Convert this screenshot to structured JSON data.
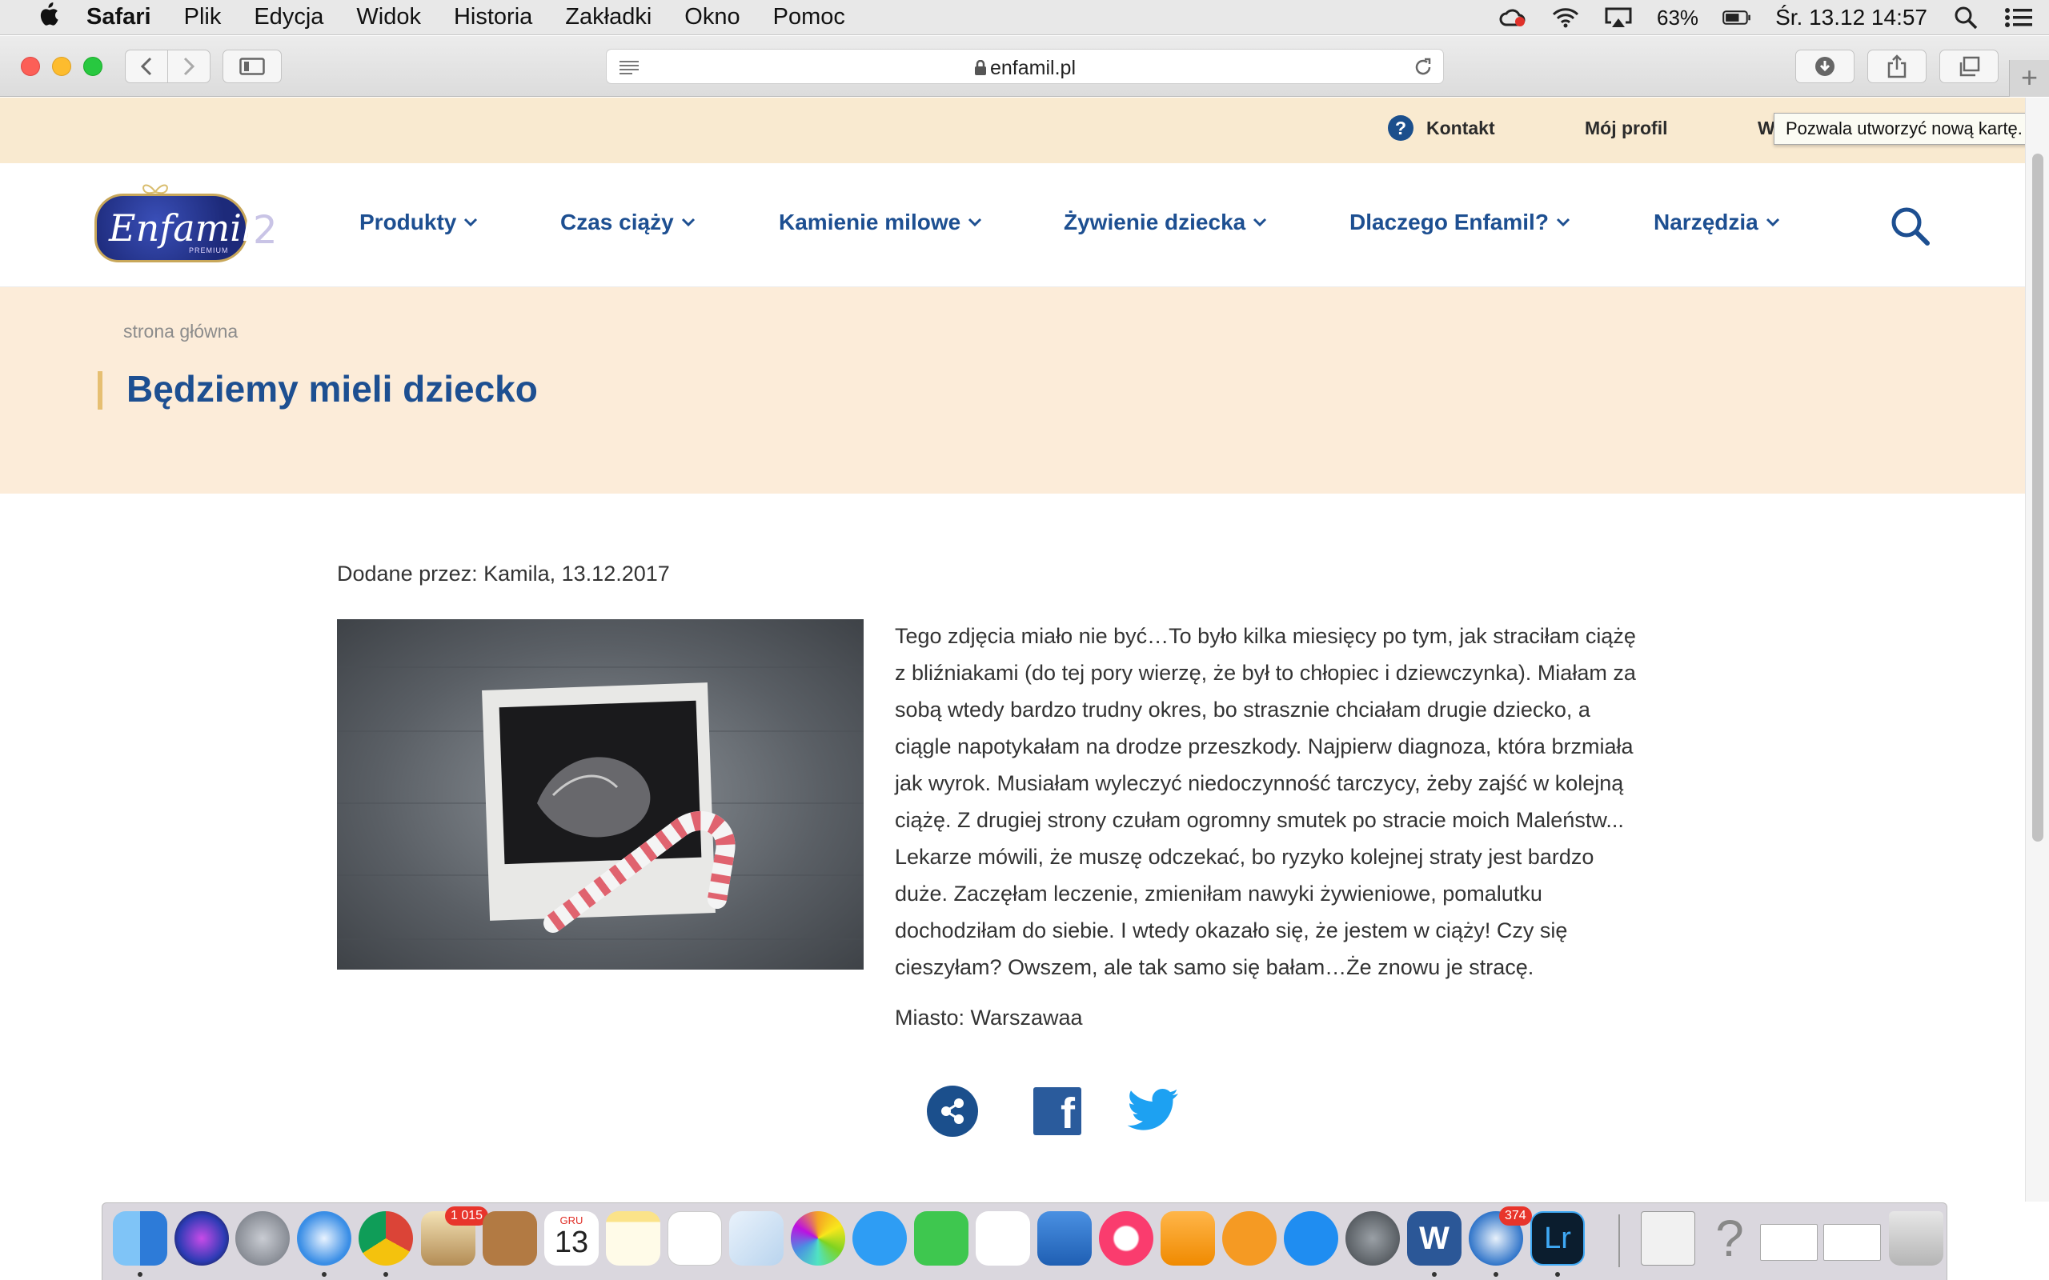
{
  "menubar": {
    "app_name": "Safari",
    "items": [
      "Plik",
      "Edycja",
      "Widok",
      "Historia",
      "Zakładki",
      "Okno",
      "Pomoc"
    ],
    "battery": "63%",
    "datetime": "Śr. 13.12  14:57"
  },
  "browser": {
    "url": "enfamil.pl",
    "tooltip": "Pozwala utworzyć nową kartę."
  },
  "site": {
    "top_links": {
      "contact": "Kontakt",
      "profile": "Mój profil",
      "truncated": "W"
    },
    "logo": {
      "wordmark": "Enfamil",
      "sub": "PREMIUM",
      "number": "2"
    },
    "nav": [
      "Produkty",
      "Czas ciąży",
      "Kamienie milowe",
      "Żywienie dziecka",
      "Dlaczego Enfamil?",
      "Narzędzia"
    ],
    "breadcrumb": "strona główna",
    "page_title": "Będziemy mieli dziecko",
    "meta": "Dodane przez: Kamila, 13.12.2017",
    "story_lines": [
      "Tego zdjęcia miało nie być…To było kilka miesięcy po tym, jak straciłam ciążę",
      "z bliźniakami (do tej pory wierzę, że był to chłopiec i dziewczynka). Miałam za",
      "sobą wtedy bardzo trudny okres, bo strasznie chciałam drugie dziecko, a",
      "ciągle napotykałam na drodze przeszkody. Najpierw diagnoza, która brzmiała",
      "jak wyrok. Musiałam wyleczyć niedoczynność tarczycy, żeby zajść w kolejną",
      "ciążę. Z drugiej strony czułam ogromny smutek po stracie moich Maleństw...",
      "Lekarze mówili, że muszę odczekać, bo ryzyko kolejnej straty jest bardzo",
      "duże. Zaczęłam leczenie, zmieniłam nawyki żywieniowe, pomalutku",
      "dochodziłam do siebie. I wtedy okazało się, że jestem w ciąży! Czy się",
      "cieszyłam? Owszem, ale tak samo się bałam…Że znowu je stracę."
    ],
    "city": "Miasto: Warszawaa",
    "share": {
      "facebook_glyph": "f"
    }
  },
  "dock": {
    "calendar_month": "GRU",
    "calendar_day": "13",
    "mail_badge": "1 015",
    "thunderbird_badge": "374",
    "lightroom_label": "Lr",
    "help_glyph": "?",
    "word_glyph": "W"
  },
  "colors": {
    "brand_blue": "#1d4f91",
    "top_strip": "#f9ead0",
    "hero_bg": "#fcecd9",
    "accent_gold": "#e6bf72"
  }
}
